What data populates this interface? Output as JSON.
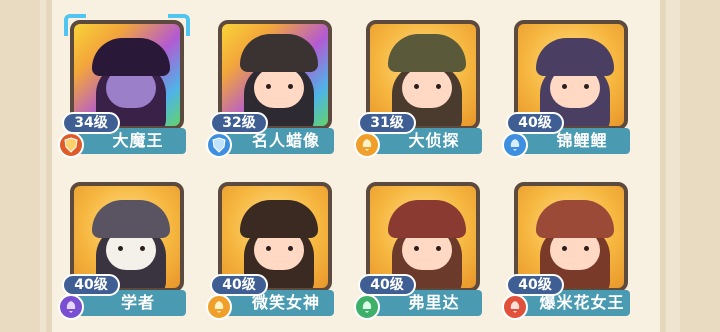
{
  "characters": [
    {
      "level": "34级",
      "name": "大魔王",
      "badge_color": "#e05a2a",
      "bg": "rainbow",
      "body_color": "#3a2148",
      "selected": true,
      "icon": "shield-icon"
    },
    {
      "level": "32级",
      "name": "名人蜡像",
      "badge_color": "#3f8fe0",
      "bg": "rainbow",
      "body_color": "#2e2a32",
      "selected": false,
      "icon": "shield-icon"
    },
    {
      "level": "31级",
      "name": "大侦探",
      "badge_color": "#f0a02a",
      "bg": "gold",
      "body_color": "#4a3b2e",
      "selected": false,
      "icon": "bell-icon"
    },
    {
      "level": "40级",
      "name": "锦鲤鲤",
      "badge_color": "#3f8fe0",
      "bg": "gold",
      "body_color": "#4a3f63",
      "selected": false,
      "icon": "bell-icon"
    },
    {
      "level": "40级",
      "name": "学者",
      "badge_color": "#7a4fd1",
      "bg": "gold",
      "body_color": "#e8e2d8",
      "selected": false,
      "icon": "bell-icon"
    },
    {
      "level": "40级",
      "name": "微笑女神",
      "badge_color": "#f0a02a",
      "bg": "gold",
      "body_color": "#3a2a22",
      "selected": false,
      "icon": "bell-icon"
    },
    {
      "level": "40级",
      "name": "弗里达",
      "badge_color": "#3fb06a",
      "bg": "gold",
      "body_color": "#6b3a2a",
      "selected": false,
      "icon": "bell-icon"
    },
    {
      "level": "40级",
      "name": "爆米花女王",
      "badge_color": "#e0503a",
      "bg": "gold",
      "body_color": "#7a3a2a",
      "selected": false,
      "icon": "bell-icon"
    }
  ]
}
